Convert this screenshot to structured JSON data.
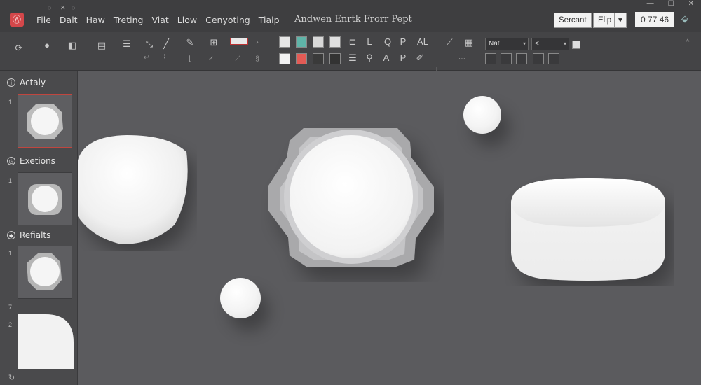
{
  "window": {
    "title": "Andwen Enrtk Frorr Pept",
    "menu": [
      "File",
      "Dalt",
      "Haw",
      "Treting",
      "Viat",
      "Llow",
      "Cenyoting",
      "Tialp"
    ],
    "quick_access": [
      "◌",
      "✕",
      "◌"
    ],
    "right_buttons": {
      "first": "Sercant",
      "second": "Elip",
      "dropdown": "▾"
    },
    "zoom": "0 77 46"
  },
  "ribbon": {
    "group1_icons": [
      "lasso-icon",
      "bucket-icon",
      "layers-icon",
      "grid-icon",
      "list-icon",
      "wand-icon",
      "line-icon"
    ],
    "text_tools": [
      "L",
      "Q",
      "P",
      "A",
      "P",
      "AL"
    ],
    "combo_a": "Nat",
    "combo_b": "<",
    "collapse": "^"
  },
  "left_panel": {
    "sections": [
      {
        "title": "Actaly",
        "number": "1"
      },
      {
        "title": "Exetions",
        "number": "1"
      },
      {
        "title": "Refialts",
        "number": "1"
      }
    ],
    "extra_numbers": [
      "7",
      "2"
    ],
    "bottom_icon": "refresh-icon"
  },
  "colors": {
    "accent_red": "#d4474a",
    "selection_border": "#c0463f",
    "canvas_bg": "#5b5b5e"
  }
}
